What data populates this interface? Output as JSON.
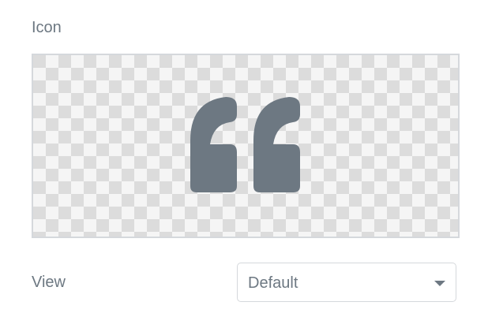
{
  "icon_field": {
    "label": "Icon",
    "icon": "quote-left-icon",
    "icon_color": "#6d7882"
  },
  "view_field": {
    "label": "View",
    "selected": "Default"
  }
}
